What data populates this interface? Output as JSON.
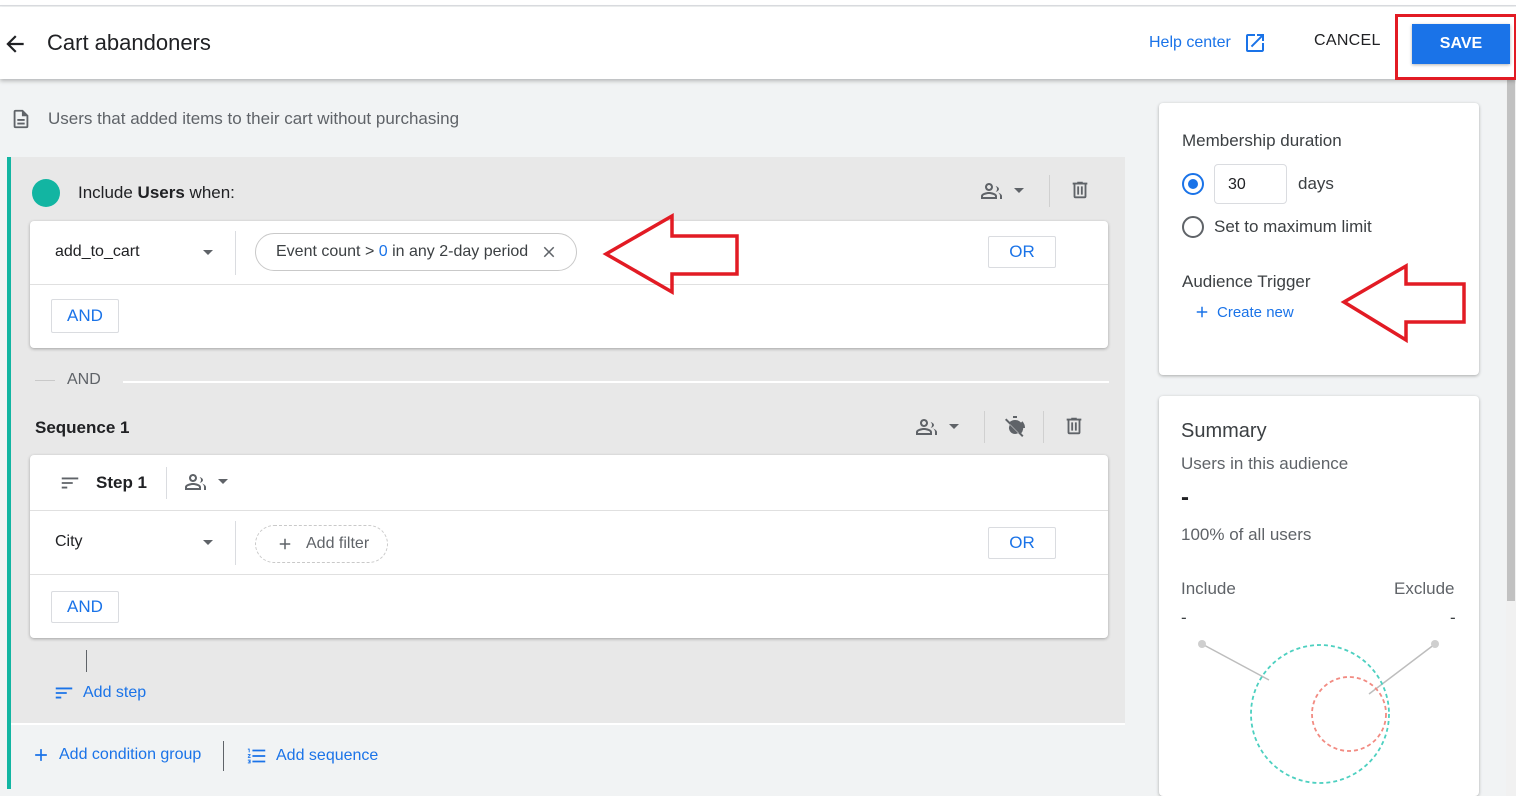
{
  "header": {
    "title": "Cart abandoners",
    "help_label": "Help center",
    "cancel_label": "CANCEL",
    "save_label": "SAVE"
  },
  "description": "Users that added items to their cart without purchasing",
  "condition_group": {
    "include_prefix": "Include ",
    "include_bold": "Users",
    "include_suffix": " when:",
    "event": "add_to_cart",
    "chip_prefix": "Event count > ",
    "chip_value": "0",
    "chip_suffix": " in any 2-day period",
    "or_label": "OR",
    "and_label": "AND"
  },
  "separator_label": "AND",
  "sequence": {
    "title": "Sequence 1",
    "step_label": "Step 1",
    "dimension": "City",
    "add_filter_label": "Add filter",
    "or_label": "OR",
    "and_label": "AND",
    "add_step_label": "Add step"
  },
  "footer": {
    "add_condition_group_label": "Add condition group",
    "add_sequence_label": "Add sequence"
  },
  "membership": {
    "title": "Membership duration",
    "days_value": "30",
    "days_unit": "days",
    "max_limit_label": "Set to maximum limit",
    "trigger_title": "Audience Trigger",
    "create_new_label": "Create new"
  },
  "summary": {
    "title": "Summary",
    "users_label": "Users in this audience",
    "users_value": "-",
    "percent_label": "100% of all users",
    "include_label": "Include",
    "exclude_label": "Exclude",
    "include_value": "-",
    "exclude_value": "-"
  },
  "colors": {
    "accent": "#1a73e8",
    "teal": "#12b5a2",
    "annotation_red": "#e21b24"
  }
}
